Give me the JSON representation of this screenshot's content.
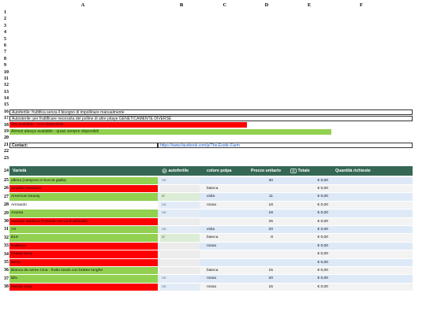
{
  "columns": [
    "A",
    "B",
    "C",
    "D",
    "E",
    "F"
  ],
  "row_numbers_top": [
    "1",
    "2",
    "3",
    "4",
    "5",
    "6",
    "7",
    "8",
    "9",
    "10",
    "11",
    "12",
    "13",
    "14",
    "15",
    "16",
    "17",
    "18",
    "19",
    "20",
    "21",
    "22",
    "23"
  ],
  "legend": {
    "autofertile": "Autofertile: fruttifica senza il bisogno di impollinare manualmente",
    "autosterile": "Autosterile: per fruttificare necessita del polline di altre pitaye GENETICAMENTE DIVERSE",
    "not_available": "Not available - non disponibile",
    "almost_always": "Almost always available - quasi sempre disponibili"
  },
  "contact": {
    "label": "Contact:",
    "link": "https://www.facebook.com/p/The-Exotic-Farm"
  },
  "table": {
    "headers": {
      "variety": "Varietà",
      "autofertile": "autofertile",
      "color": "colore polpa",
      "price": "Prezzo unitario",
      "total": "Totale",
      "qty": "Quantità richieste"
    },
    "rows": [
      {
        "n": "25",
        "variety": "albina (camporo is buccia gialla)",
        "status": "green",
        "auto": "no",
        "color": "",
        "price": "30",
        "total": "€ 0,00",
        "band": "B"
      },
      {
        "n": "26",
        "variety": "amarillo mericano",
        "status": "red",
        "auto": "",
        "color": "bianca",
        "price": "",
        "total": "€ 0,00",
        "band": "A"
      },
      {
        "n": "27",
        "variety": "American beauty",
        "status": "green",
        "auto": "si",
        "color": "viola",
        "price": "11",
        "total": "€ 0,00",
        "band": "B"
      },
      {
        "n": "28",
        "variety": "Armando",
        "status": "white",
        "auto": "no",
        "color": "rossa",
        "price": "18",
        "total": "€ 0,00",
        "band": "A"
      },
      {
        "n": "29",
        "variety": "Asunta",
        "status": "green",
        "auto": "no",
        "color": "",
        "price": "18",
        "total": "€ 0,00",
        "band": "B"
      },
      {
        "n": "30",
        "variety": "asunta1 starbust (3 piante non sa fruttificate)",
        "status": "red",
        "auto": "",
        "color": "",
        "price": "25",
        "total": "€ 0,00",
        "band": "A"
      },
      {
        "n": "31",
        "variety": "AX",
        "status": "green",
        "auto": "no",
        "color": "viola",
        "price": "20",
        "total": "€ 0,00",
        "band": "B"
      },
      {
        "n": "32",
        "variety": "B19",
        "status": "green",
        "auto": "si",
        "color": "bianca",
        "price": "8",
        "total": "€ 0,00",
        "band": "A"
      },
      {
        "n": "33",
        "variety": "Baltanco",
        "status": "red",
        "auto": "",
        "color": "rossa",
        "price": "",
        "total": "€ 0,00",
        "band": "B"
      },
      {
        "n": "34",
        "variety": "beauty berry",
        "status": "red",
        "auto": "",
        "color": "",
        "price": "",
        "total": "€ 0,00",
        "band": "A"
      },
      {
        "n": "35",
        "variety": "Berry",
        "status": "red",
        "auto": "",
        "color": "",
        "price": "",
        "total": "€ 0,00",
        "band": "B"
      },
      {
        "n": "36",
        "variety": "Bianca da seme Cina - frutto tondo con bratee lunghe",
        "status": "green",
        "auto": "",
        "color": "bianca",
        "price": "15",
        "total": "€ 0,00",
        "band": "A"
      },
      {
        "n": "37",
        "variety": "Bilu",
        "status": "green",
        "auto": "no",
        "color": "rossa",
        "price": "20",
        "total": "€ 0,00",
        "band": "B"
      },
      {
        "n": "38",
        "variety": "bloody mary",
        "status": "red",
        "auto": "no",
        "color": "rossa",
        "price": "15",
        "total": "€ 0,00",
        "band": "A"
      }
    ]
  },
  "colors": {
    "header_bg": "#356854",
    "not_available": "#ff0000",
    "available": "#92d050"
  }
}
